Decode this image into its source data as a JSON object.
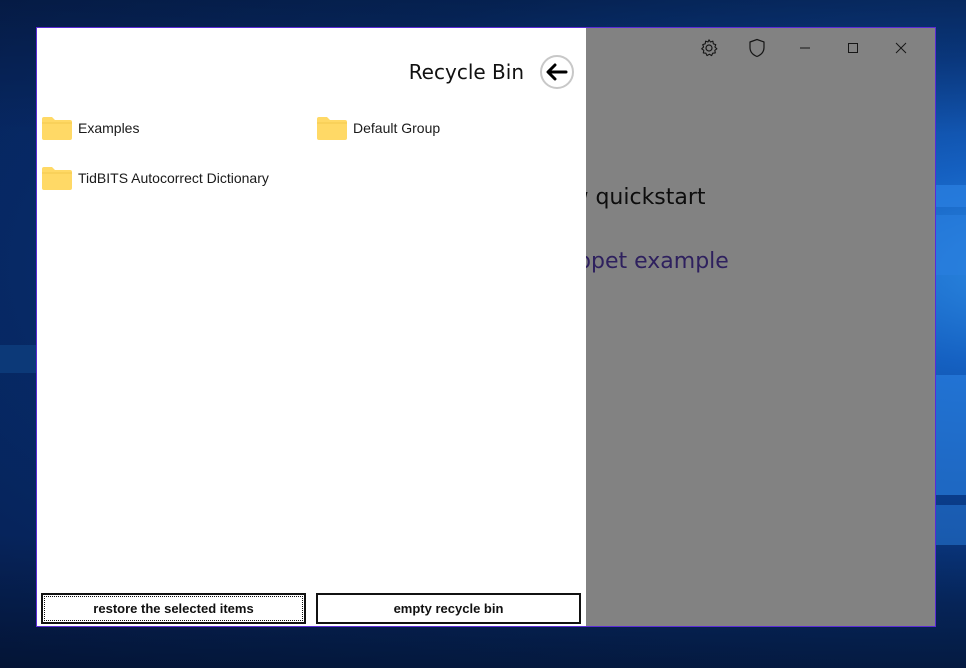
{
  "main_window": {
    "heading_fragment": "ow quickstart",
    "link_fragment": "nippet example"
  },
  "titlebar": {
    "icons": [
      "gear-icon",
      "shield-icon",
      "minimize-icon",
      "maximize-icon",
      "close-icon"
    ]
  },
  "recycle_bin": {
    "title": "Recycle Bin",
    "back_icon": "arrow-left-icon",
    "folders": [
      {
        "label": "Examples",
        "icon": "folder-icon"
      },
      {
        "label": "Default Group",
        "icon": "folder-icon"
      },
      {
        "label": "TidBITS Autocorrect Dictionary",
        "icon": "folder-icon"
      }
    ],
    "restore_label": "restore the selected items",
    "empty_label": "empty recycle bin"
  },
  "colors": {
    "folder": "#ffd966",
    "window_border": "#5b2bd6",
    "link": "#5a3fb8",
    "overlay": "rgba(0,0,0,0.49)"
  }
}
